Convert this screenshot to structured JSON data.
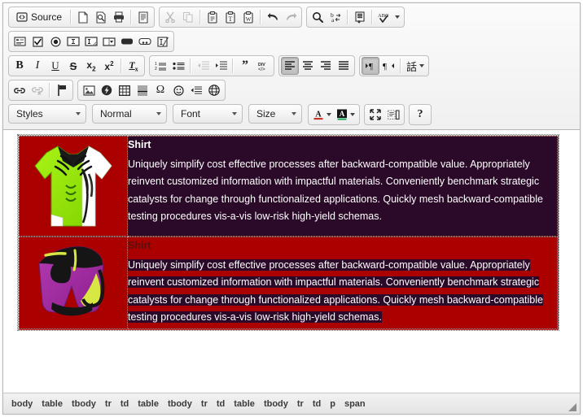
{
  "toolbar": {
    "row1": {
      "group1": [
        {
          "name": "source-button",
          "label": "Source",
          "icon": "source-icon",
          "state": "normal"
        },
        {
          "name": "new-page-button",
          "label": "",
          "icon": "new-page-icon",
          "state": "normal"
        },
        {
          "name": "preview-button",
          "label": "",
          "icon": "preview-icon",
          "state": "normal"
        },
        {
          "name": "print-button",
          "label": "",
          "icon": "print-icon",
          "state": "normal"
        },
        {
          "name": "templates-button",
          "label": "",
          "icon": "templates-icon",
          "state": "normal"
        }
      ],
      "group2": [
        {
          "name": "cut-button",
          "label": "",
          "icon": "scissors-icon",
          "state": "disabled"
        },
        {
          "name": "copy-button",
          "label": "",
          "icon": "copy-icon",
          "state": "disabled"
        },
        {
          "name": "paste-button",
          "label": "",
          "icon": "clipboard-icon",
          "state": "normal"
        },
        {
          "name": "paste-text-button",
          "label": "",
          "icon": "clipboard-text-icon",
          "state": "normal"
        },
        {
          "name": "paste-word-button",
          "label": "",
          "icon": "clipboard-word-icon",
          "state": "normal"
        },
        {
          "name": "undo-button",
          "label": "",
          "icon": "undo-arrow-icon",
          "state": "normal"
        },
        {
          "name": "redo-button",
          "label": "",
          "icon": "redo-arrow-icon",
          "state": "disabled"
        }
      ],
      "group3": [
        {
          "name": "find-button",
          "label": "",
          "icon": "magnifier-icon",
          "state": "normal"
        },
        {
          "name": "replace-button",
          "label": "",
          "icon": "replace-icon",
          "state": "normal"
        },
        {
          "name": "select-all-button",
          "label": "",
          "icon": "select-all-icon",
          "state": "normal"
        },
        {
          "name": "spellcheck-button",
          "label": "",
          "icon": "spellcheck-icon",
          "state": "normal",
          "has_arrow": true
        }
      ]
    },
    "row2": {
      "group1": [
        {
          "name": "form-button",
          "label": "",
          "icon": "form-icon",
          "state": "normal"
        },
        {
          "name": "checkbox-button",
          "label": "",
          "icon": "checkbox-icon",
          "state": "normal"
        },
        {
          "name": "radio-button",
          "label": "",
          "icon": "radio-icon",
          "state": "normal"
        },
        {
          "name": "text-field-button",
          "label": "",
          "icon": "text-field-icon",
          "state": "normal"
        },
        {
          "name": "textarea-button",
          "label": "",
          "icon": "textarea-icon",
          "state": "normal"
        },
        {
          "name": "select-field-button",
          "label": "",
          "icon": "select-field-icon",
          "state": "normal"
        },
        {
          "name": "form-button-button",
          "label": "",
          "icon": "button-icon",
          "state": "normal"
        },
        {
          "name": "image-button-button",
          "label": "",
          "icon": "image-button-icon",
          "state": "normal"
        },
        {
          "name": "hidden-field-button",
          "label": "",
          "icon": "hidden-field-icon",
          "state": "normal"
        }
      ]
    },
    "row3": {
      "group1": [
        {
          "name": "bold-button",
          "label": "B",
          "icon": "bold-icon",
          "state": "normal"
        },
        {
          "name": "italic-button",
          "label": "I",
          "icon": "italic-icon",
          "state": "normal"
        },
        {
          "name": "underline-button",
          "label": "U",
          "icon": "underline-icon",
          "state": "normal"
        },
        {
          "name": "strike-button",
          "label": "S",
          "icon": "strikethrough-icon",
          "state": "normal"
        },
        {
          "name": "subscript-button",
          "label": "x₂",
          "icon": "subscript-icon",
          "state": "normal"
        },
        {
          "name": "superscript-button",
          "label": "x²",
          "icon": "superscript-icon",
          "state": "normal"
        },
        {
          "name": "remove-format-button",
          "label": "Tx",
          "icon": "remove-format-icon",
          "state": "normal"
        }
      ],
      "group2": [
        {
          "name": "numbered-list-button",
          "label": "",
          "icon": "numbered-list-icon",
          "state": "normal"
        },
        {
          "name": "bulleted-list-button",
          "label": "",
          "icon": "bulleted-list-icon",
          "state": "normal"
        },
        {
          "name": "outdent-button",
          "label": "",
          "icon": "outdent-icon",
          "state": "disabled"
        },
        {
          "name": "indent-button",
          "label": "",
          "icon": "indent-icon",
          "state": "normal"
        },
        {
          "name": "blockquote-button",
          "label": "",
          "icon": "blockquote-icon",
          "state": "normal"
        },
        {
          "name": "create-div-button",
          "label": "",
          "icon": "div-container-icon",
          "state": "normal"
        }
      ],
      "group3": [
        {
          "name": "align-left-button",
          "label": "",
          "icon": "align-left-icon",
          "state": "active"
        },
        {
          "name": "align-center-button",
          "label": "",
          "icon": "align-center-icon",
          "state": "normal"
        },
        {
          "name": "align-right-button",
          "label": "",
          "icon": "align-right-icon",
          "state": "normal"
        },
        {
          "name": "align-justify-button",
          "label": "",
          "icon": "align-justify-icon",
          "state": "normal"
        }
      ],
      "group4": [
        {
          "name": "ltr-button",
          "label": "",
          "icon": "text-direction-ltr-icon",
          "state": "active"
        },
        {
          "name": "rtl-button",
          "label": "",
          "icon": "text-direction-rtl-icon",
          "state": "normal"
        },
        {
          "name": "language-button",
          "label": "話",
          "icon": "language-icon",
          "state": "normal",
          "has_arrow": true
        }
      ]
    },
    "row4": {
      "group1": [
        {
          "name": "link-button",
          "label": "",
          "icon": "link-icon",
          "state": "normal"
        },
        {
          "name": "unlink-button",
          "label": "",
          "icon": "unlink-icon",
          "state": "disabled"
        },
        {
          "name": "anchor-button",
          "label": "",
          "icon": "anchor-flag-icon",
          "state": "normal"
        }
      ],
      "group2": [
        {
          "name": "image-button",
          "label": "",
          "icon": "image-icon",
          "state": "normal"
        },
        {
          "name": "flash-button",
          "label": "",
          "icon": "flash-icon",
          "state": "normal"
        },
        {
          "name": "table-button",
          "label": "",
          "icon": "table-icon",
          "state": "normal"
        },
        {
          "name": "horizontal-rule-button",
          "label": "",
          "icon": "horizontal-rule-icon",
          "state": "normal"
        },
        {
          "name": "special-char-button",
          "label": "Ω",
          "icon": "omega-icon",
          "state": "normal"
        },
        {
          "name": "smiley-button",
          "label": "",
          "icon": "smiley-icon",
          "state": "normal"
        },
        {
          "name": "page-break-button",
          "label": "",
          "icon": "page-break-icon",
          "state": "normal"
        },
        {
          "name": "iframe-button",
          "label": "",
          "icon": "globe-icon",
          "state": "normal"
        }
      ]
    },
    "row5": {
      "combos": [
        {
          "name": "styles-combo",
          "label": "Styles"
        },
        {
          "name": "paragraph-format-combo",
          "label": "Normal"
        },
        {
          "name": "font-combo",
          "label": "Font"
        },
        {
          "name": "size-combo",
          "label": "Size"
        }
      ],
      "group1": [
        {
          "name": "text-color-button",
          "label": "A",
          "icon": "text-color-icon",
          "state": "normal",
          "has_arrow": true
        },
        {
          "name": "background-color-button",
          "label": "A",
          "icon": "background-color-icon",
          "state": "normal",
          "has_arrow": true
        }
      ],
      "group2": [
        {
          "name": "maximize-button",
          "label": "",
          "icon": "maximize-icon",
          "state": "normal"
        },
        {
          "name": "show-blocks-button",
          "label": "",
          "icon": "show-blocks-icon",
          "state": "normal"
        }
      ],
      "group3": [
        {
          "name": "about-button",
          "label": "?",
          "icon": "question-mark-icon",
          "state": "normal"
        }
      ]
    }
  },
  "content": {
    "rows": [
      {
        "image_alt": "green-sports-jersey",
        "cell_background": "#2a0a28",
        "title": "Shirt",
        "selected": false,
        "paragraph": "Uniquely simplify cost effective processes after backward-compatible value. Appropriately reinvent customized information with impactful materials. Conveniently benchmark strategic catalysts for change through functionalized applications. Quickly mesh backward-compatible testing procedures vis-a-vis low-risk high-yield schemas."
      },
      {
        "image_alt": "purple-sports-shorts",
        "cell_background": "#aa0000",
        "title": "Shirt",
        "selected": true,
        "paragraph": "Uniquely simplify cost effective processes after backward-compatible value. Appropriately reinvent customized information with impactful materials. Conveniently benchmark strategic catalysts for change through functionalized applications. Quickly mesh backward-compatible testing procedures vis-a-vis low-risk high-yield schemas."
      }
    ],
    "colors": {
      "table_red": "#aa0000",
      "cell_purple": "#2a0a28",
      "selection_highlight": "#2a0a28",
      "text_white": "#ffffff",
      "dim_title": "#5b1010"
    }
  },
  "statusbar": {
    "element_path": [
      "body",
      "table",
      "tbody",
      "tr",
      "td",
      "table",
      "tbody",
      "tr",
      "td",
      "table",
      "tbody",
      "tr",
      "td",
      "p",
      "span"
    ],
    "resize_handle": "resize-grip"
  }
}
